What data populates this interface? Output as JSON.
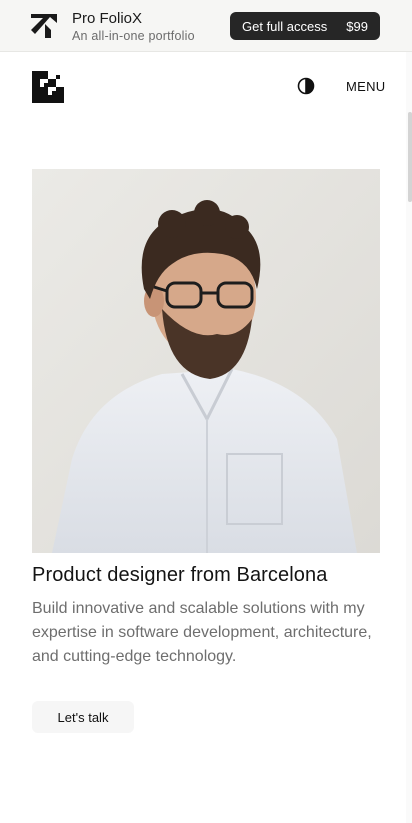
{
  "promo": {
    "title": "Pro FolioX",
    "subtitle": "An all-in-one portfolio",
    "cta_label": "Get full access",
    "price": "$99"
  },
  "header": {
    "logo_icon": "checker-logo-icon",
    "theme_icon": "contrast-icon",
    "menu_label": "MENU"
  },
  "hero": {
    "photo_alt": "",
    "headline": "Product designer from Barcelona",
    "description": "Build innovative and scalable solutions with my expertise in software development, architecture, and cutting-edge technology.",
    "cta_label": "Let's talk"
  },
  "colors": {
    "banner_bg": "#f6f6f4",
    "cta_dark": "#262626",
    "muted_text": "#6e6e6e"
  }
}
